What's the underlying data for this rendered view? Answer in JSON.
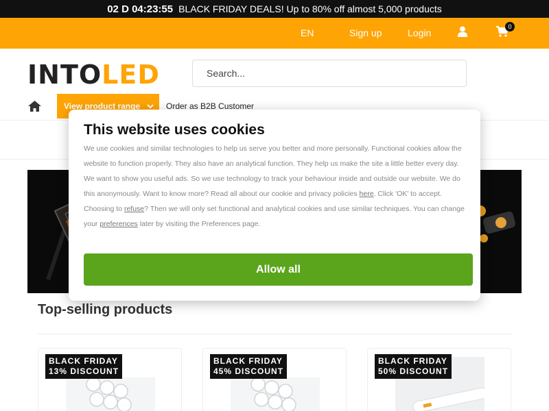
{
  "promo": {
    "timer": "02 D 04:23:55",
    "text": "BLACK FRIDAY DEALS! Up to 80% off almost 5,000 products"
  },
  "topnav": {
    "language": "EN",
    "signup": "Sign up",
    "login": "Login",
    "cart_count": "0"
  },
  "logo": {
    "part1": "INTO",
    "part2": "LED"
  },
  "search": {
    "placeholder": "Search..."
  },
  "nav": {
    "range_label": "View product range",
    "b2b_label": "Order as B2B Customer"
  },
  "cookie": {
    "title": "This website uses cookies",
    "text_1": "We use cookies and similar technologies to help us serve you better and more personally. Functional cookies allow the website to function properly. They also have an analytical function. They help us make the site a little better every day. We want to show you useful ads. So we use technology to track your behaviour inside and outside our website. We do this anonymously. Want to know more? Read all about our cookie and privacy policies ",
    "link_here": "here",
    "text_2": ". Click 'OK' to accept. Choosing to ",
    "link_refuse": "refuse",
    "text_3": "? Then we will only set functional and analytical cookies and use similar techniques. You can change your ",
    "link_preferences": "preferences",
    "text_4": " later by visiting the Preferences page.",
    "allow_all": "Allow all"
  },
  "section": {
    "title": "Top-selling products"
  },
  "products": [
    {
      "badge_line1": "BLACK FRIDAY",
      "badge_line2": "13% DISCOUNT"
    },
    {
      "badge_line1": "BLACK FRIDAY",
      "badge_line2": "45% DISCOUNT"
    },
    {
      "badge_line1": "BLACK FRIDAY",
      "badge_line2": "50% DISCOUNT"
    }
  ],
  "colors": {
    "brand_orange": "#ffa405",
    "allow_green": "#5aa51c",
    "promo_black": "#111111"
  }
}
